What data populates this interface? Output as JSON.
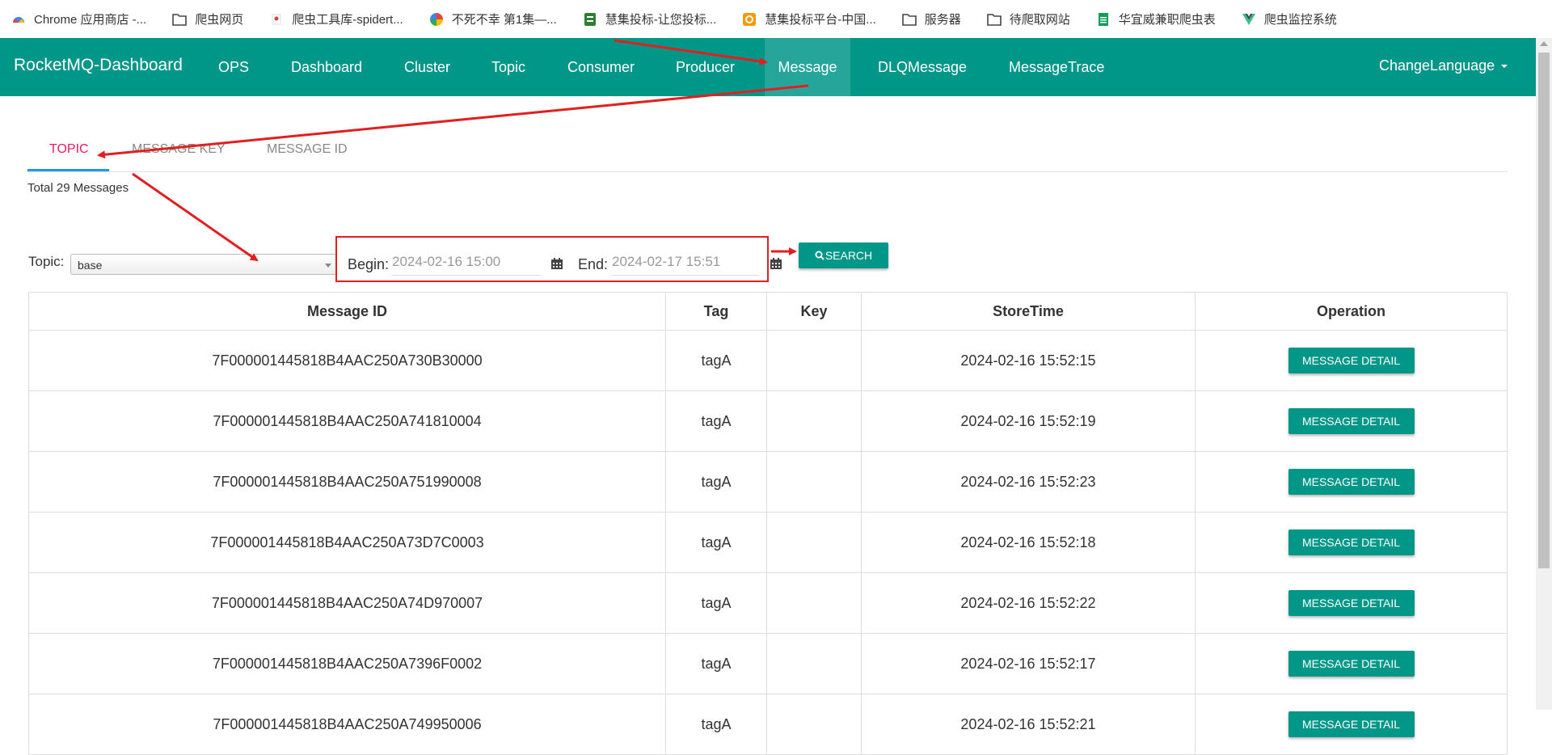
{
  "bookmarks": [
    {
      "label": "Chrome 应用商店 -...",
      "icon": "chrome-webstore-icon"
    },
    {
      "label": "爬虫网页",
      "icon": "folder-icon"
    },
    {
      "label": "爬虫工具库-spidert...",
      "icon": "spider-tool-icon"
    },
    {
      "label": "不死不幸 第1集—...",
      "icon": "pinwheel-icon"
    },
    {
      "label": "慧集投标-让您投标...",
      "icon": "huiji-icon"
    },
    {
      "label": "慧集投标平台-中国...",
      "icon": "huiji-platform-icon"
    },
    {
      "label": "服务器",
      "icon": "folder-icon"
    },
    {
      "label": "待爬取网站",
      "icon": "folder-icon"
    },
    {
      "label": "华宜威兼职爬虫表",
      "icon": "sheet-icon"
    },
    {
      "label": "爬虫监控系统",
      "icon": "vue-icon"
    }
  ],
  "navbar": {
    "brand": "RocketMQ-Dashboard",
    "items": [
      "OPS",
      "Dashboard",
      "Cluster",
      "Topic",
      "Consumer",
      "Producer",
      "Message",
      "DLQMessage",
      "MessageTrace"
    ],
    "active": "Message",
    "language": "ChangeLanguage"
  },
  "tabs": [
    "TOPIC",
    "MESSAGE KEY",
    "MESSAGE ID"
  ],
  "active_tab": "TOPIC",
  "total": "Total 29 Messages",
  "filter": {
    "topic_label": "Topic:",
    "topic_value": "base",
    "begin_label": "Begin:",
    "begin_value": "2024-02-16 15:00",
    "end_label": "End:",
    "end_value": "2024-02-17 15:51",
    "search_label": "SEARCH"
  },
  "table": {
    "headers": [
      "Message ID",
      "Tag",
      "Key",
      "StoreTime",
      "Operation"
    ],
    "rows": [
      {
        "id": "7F000001445818B4AAC250A730B30000",
        "tag": "tagA",
        "key": "",
        "time": "2024-02-16 15:52:15",
        "op": "MESSAGE DETAIL"
      },
      {
        "id": "7F000001445818B4AAC250A741810004",
        "tag": "tagA",
        "key": "",
        "time": "2024-02-16 15:52:19",
        "op": "MESSAGE DETAIL"
      },
      {
        "id": "7F000001445818B4AAC250A751990008",
        "tag": "tagA",
        "key": "",
        "time": "2024-02-16 15:52:23",
        "op": "MESSAGE DETAIL"
      },
      {
        "id": "7F000001445818B4AAC250A73D7C0003",
        "tag": "tagA",
        "key": "",
        "time": "2024-02-16 15:52:18",
        "op": "MESSAGE DETAIL"
      },
      {
        "id": "7F000001445818B4AAC250A74D970007",
        "tag": "tagA",
        "key": "",
        "time": "2024-02-16 15:52:22",
        "op": "MESSAGE DETAIL"
      },
      {
        "id": "7F000001445818B4AAC250A7396F0002",
        "tag": "tagA",
        "key": "",
        "time": "2024-02-16 15:52:17",
        "op": "MESSAGE DETAIL"
      },
      {
        "id": "7F000001445818B4AAC250A749950006",
        "tag": "tagA",
        "key": "",
        "time": "2024-02-16 15:52:21",
        "op": "MESSAGE DETAIL"
      }
    ]
  },
  "colors": {
    "primary": "#009688",
    "active_nav": "#26a69a",
    "active_tab": "#e91e63",
    "annotation": "#e02020"
  }
}
